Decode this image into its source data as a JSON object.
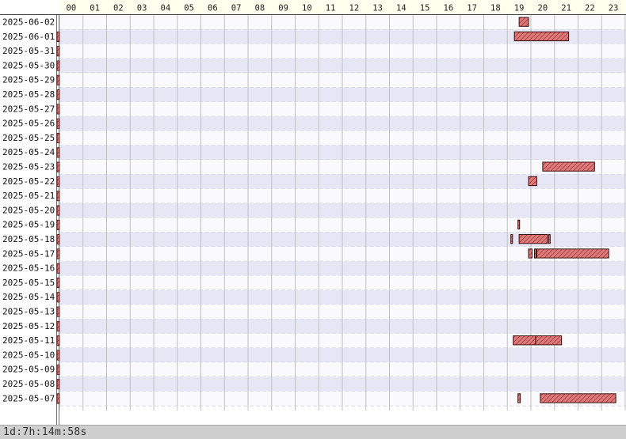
{
  "hour_labels": [
    "00",
    "01",
    "02",
    "03",
    "04",
    "05",
    "06",
    "07",
    "08",
    "09",
    "10",
    "11",
    "12",
    "13",
    "14",
    "15",
    "16",
    "17",
    "18",
    "19",
    "20",
    "21",
    "22",
    "23"
  ],
  "status": {
    "total_duration": "1d:7h:14m:58s"
  },
  "colors": {
    "bar_fill": "#e07a7a",
    "bar_stripe": "#8a2a2a",
    "row_shade": "#e6e6f4",
    "row_plain": "#fafafc",
    "header_bg": "#ffffee",
    "status_bg": "#cfcfcf"
  },
  "chart_data": {
    "type": "gantt",
    "x_unit": "hour of day",
    "xlim": [
      0,
      24
    ],
    "rows": [
      {
        "date": "2025-06-02",
        "sessions": [
          [
            19.5,
            19.9
          ]
        ]
      },
      {
        "date": "2025-06-01",
        "sessions": [
          [
            19.3,
            21.6
          ]
        ]
      },
      {
        "date": "2025-05-31",
        "sessions": []
      },
      {
        "date": "2025-05-30",
        "sessions": []
      },
      {
        "date": "2025-05-29",
        "sessions": []
      },
      {
        "date": "2025-05-28",
        "sessions": []
      },
      {
        "date": "2025-05-27",
        "sessions": []
      },
      {
        "date": "2025-05-26",
        "sessions": []
      },
      {
        "date": "2025-05-25",
        "sessions": []
      },
      {
        "date": "2025-05-24",
        "sessions": []
      },
      {
        "date": "2025-05-23",
        "sessions": [
          [
            20.5,
            22.7
          ]
        ]
      },
      {
        "date": "2025-05-22",
        "sessions": [
          [
            19.9,
            20.25
          ]
        ]
      },
      {
        "date": "2025-05-21",
        "sessions": []
      },
      {
        "date": "2025-05-20",
        "sessions": []
      },
      {
        "date": "2025-05-19",
        "sessions": [
          [
            19.45,
            19.52
          ]
        ]
      },
      {
        "date": "2025-05-18",
        "sessions": [
          [
            19.15,
            19.22
          ],
          [
            19.5,
            20.7
          ],
          [
            20.75,
            20.8
          ]
        ]
      },
      {
        "date": "2025-05-17",
        "sessions": [
          [
            19.9,
            20.05
          ],
          [
            20.15,
            20.2
          ],
          [
            20.25,
            23.3
          ]
        ]
      },
      {
        "date": "2025-05-16",
        "sessions": []
      },
      {
        "date": "2025-05-15",
        "sessions": []
      },
      {
        "date": "2025-05-14",
        "sessions": []
      },
      {
        "date": "2025-05-13",
        "sessions": []
      },
      {
        "date": "2025-05-12",
        "sessions": []
      },
      {
        "date": "2025-05-11",
        "sessions": [
          [
            19.25,
            20.2
          ],
          [
            20.2,
            21.3
          ]
        ]
      },
      {
        "date": "2025-05-10",
        "sessions": []
      },
      {
        "date": "2025-05-09",
        "sessions": []
      },
      {
        "date": "2025-05-08",
        "sessions": []
      },
      {
        "date": "2025-05-07",
        "sessions": [
          [
            19.45,
            19.55
          ],
          [
            20.4,
            23.6
          ]
        ]
      }
    ],
    "midnight_carryover_marker_rows": [
      "2025-06-01",
      "2025-05-31",
      "2025-05-30",
      "2025-05-29",
      "2025-05-28",
      "2025-05-27",
      "2025-05-26",
      "2025-05-25",
      "2025-05-24",
      "2025-05-23",
      "2025-05-22",
      "2025-05-21",
      "2025-05-20",
      "2025-05-19",
      "2025-05-18",
      "2025-05-17",
      "2025-05-16",
      "2025-05-15",
      "2025-05-14",
      "2025-05-13",
      "2025-05-12",
      "2025-05-11",
      "2025-05-10",
      "2025-05-09",
      "2025-05-08",
      "2025-05-07"
    ]
  }
}
